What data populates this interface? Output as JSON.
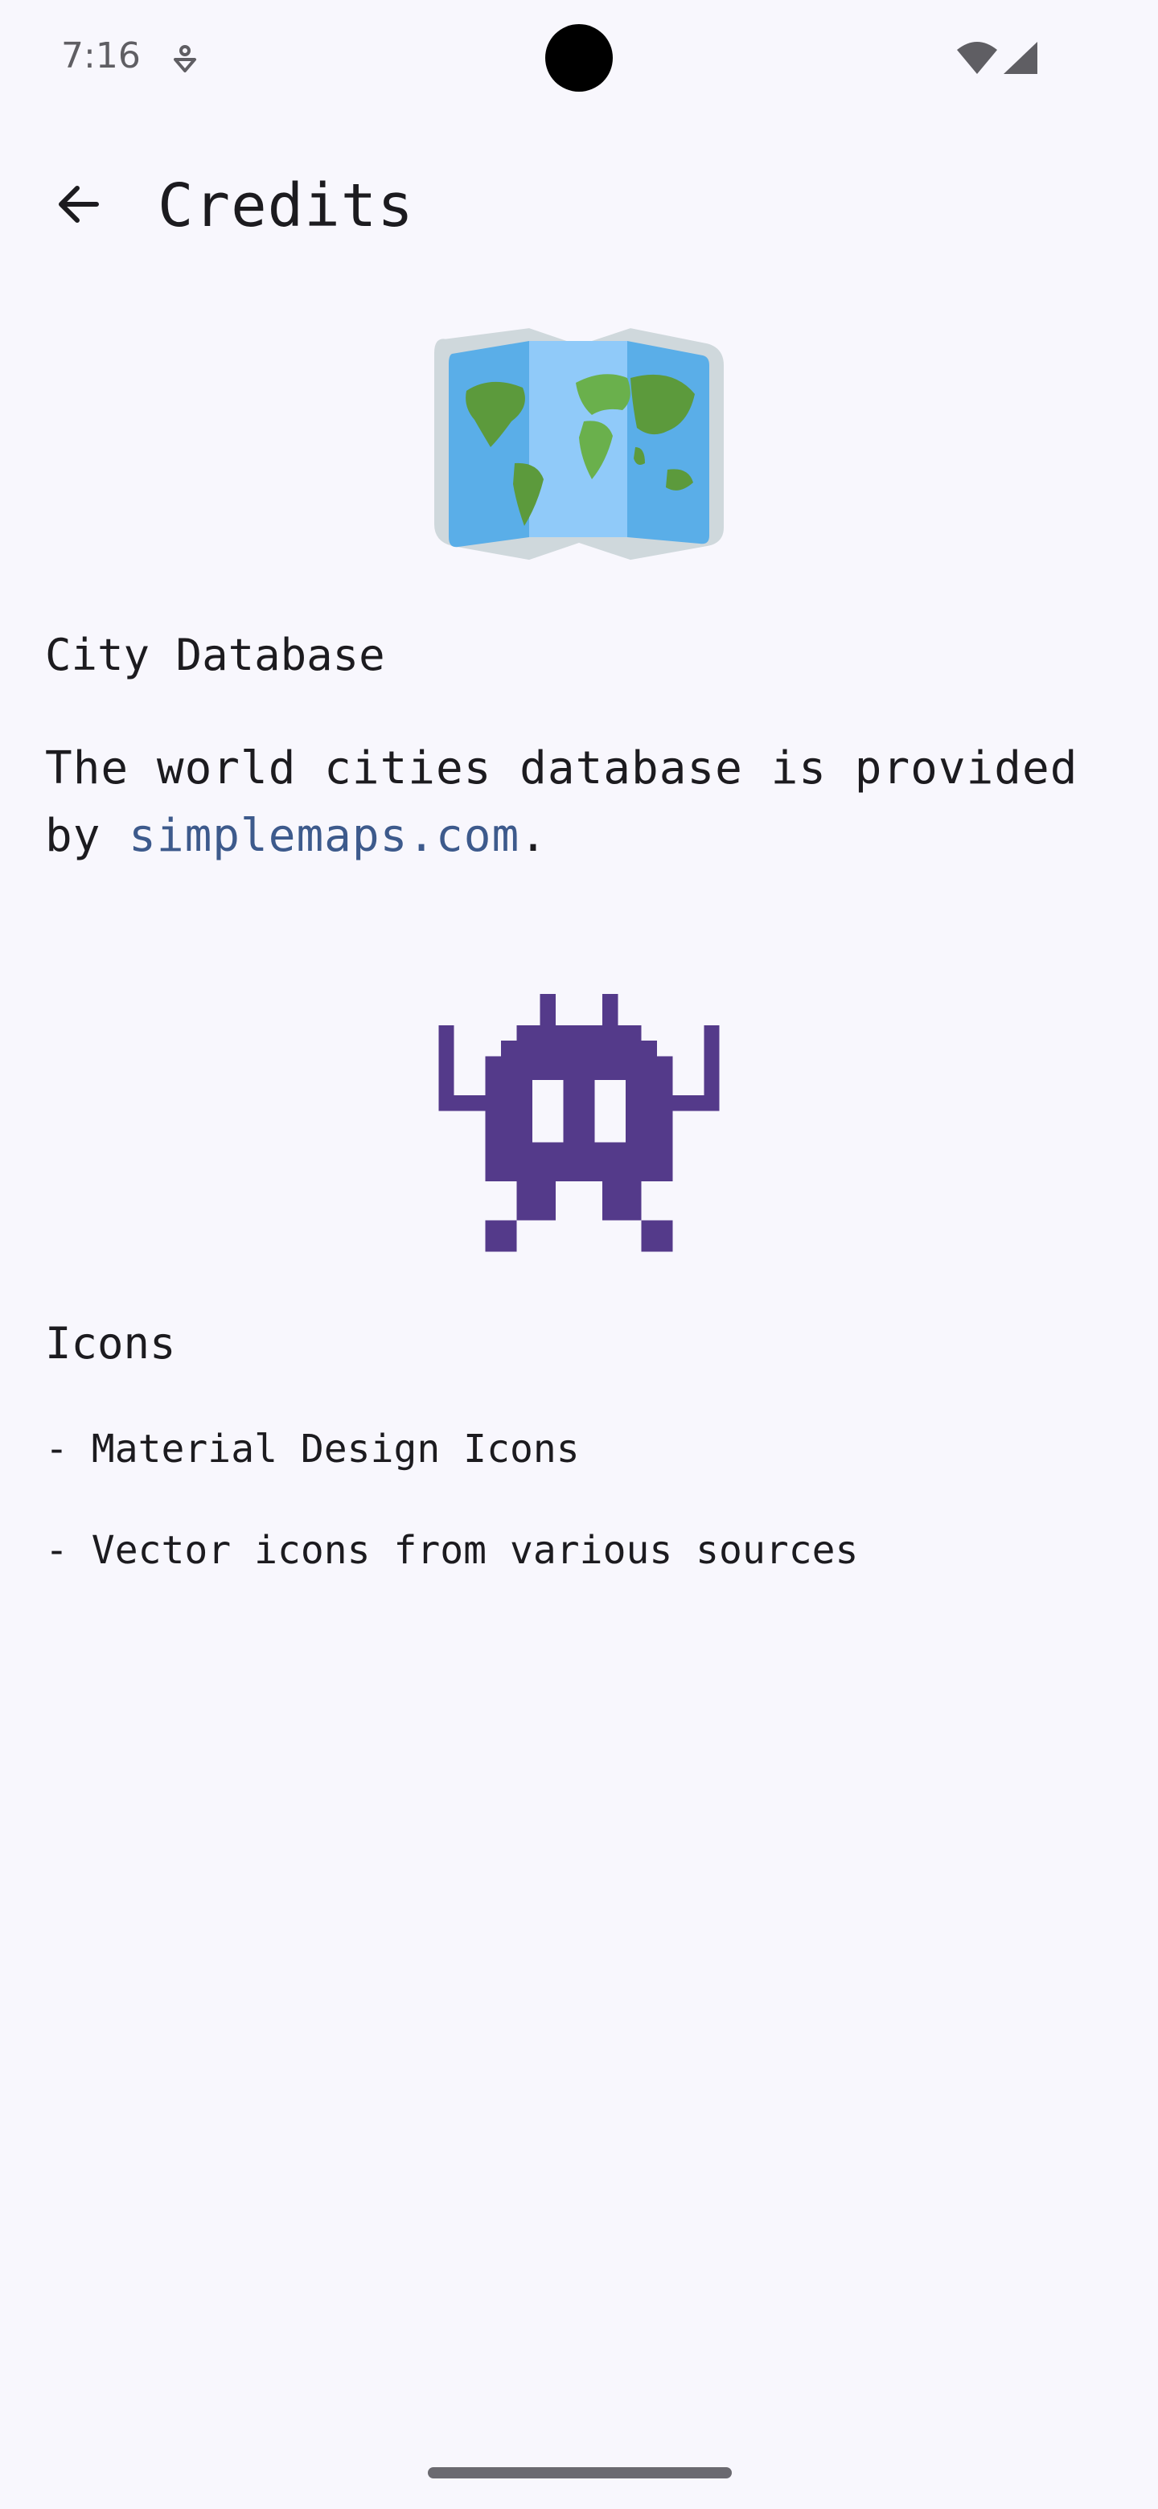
{
  "status_bar": {
    "time": "7:16",
    "icons": [
      "notification-icon",
      "wifi-icon",
      "signal-icon"
    ]
  },
  "app_bar": {
    "title": "Credits",
    "back_icon": "arrow-back-icon"
  },
  "sections": {
    "city": {
      "image_icon": "world-map-icon",
      "title": "City Database",
      "text_before": "The world cities database is provided by ",
      "link_text": "simplemaps.com",
      "text_after": "."
    },
    "icons": {
      "image_icon": "pixel-robot-icon",
      "title": "Icons",
      "items": [
        "- Material Design Icons",
        "- Vector icons from various sources"
      ]
    }
  },
  "colors": {
    "background": "#f8f7fd",
    "link": "#3d5a8c",
    "robot": "#543a8a",
    "map_blue": "#5aaee8",
    "map_land": "#5c9a3c"
  }
}
